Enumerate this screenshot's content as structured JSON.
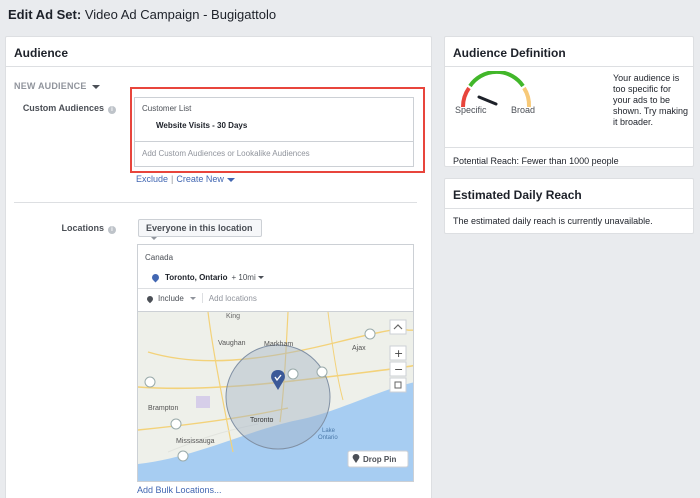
{
  "header": {
    "lead": "Edit Ad Set:",
    "title": "Video Ad Campaign - Bugigattolo"
  },
  "audience": {
    "title": "Audience",
    "new_audience_label": "NEW AUDIENCE",
    "custom_audiences": {
      "label": "Custom Audiences",
      "category": "Customer List",
      "item": "Website Visits - 30 Days",
      "placeholder": "Add Custom Audiences or Lookalike Audiences",
      "exclude_link": "Exclude",
      "create_new_link": "Create New"
    },
    "locations": {
      "label": "Locations",
      "selector_value": "Everyone in this location",
      "country": "Canada",
      "city": "Toronto, Ontario",
      "radius": "+ 10mi",
      "include_label": "Include",
      "add_placeholder": "Add locations",
      "bulk_link": "Add Bulk Locations..."
    },
    "map": {
      "labels": {
        "king": "King",
        "vaughan": "Vaughan",
        "markham": "Markham",
        "ajax": "Ajax",
        "brampton": "Brampton",
        "toronto": "Toronto",
        "mississauga": "Mississauga",
        "lake": "Lake",
        "ontario": "Ontario"
      },
      "zoom_in": "+",
      "zoom_out": "−",
      "drop_pin_label": "Drop Pin"
    }
  },
  "definition": {
    "title": "Audience Definition",
    "message": "Your audience is too specific for your ads to be shown. Try making it broader.",
    "specific_label": "Specific",
    "broad_label": "Broad",
    "potential_reach": "Potential Reach: Fewer than 1000 people"
  },
  "daily_reach": {
    "title": "Estimated Daily Reach",
    "message": "The estimated daily reach is currently unavailable."
  },
  "colors": {
    "link_blue": "#4267b2",
    "highlight_red": "#e8453c",
    "gauge_red": "#e8453c",
    "gauge_green": "#42b72a",
    "gauge_orange": "#f7c978",
    "pin_blue": "#3b5998"
  }
}
